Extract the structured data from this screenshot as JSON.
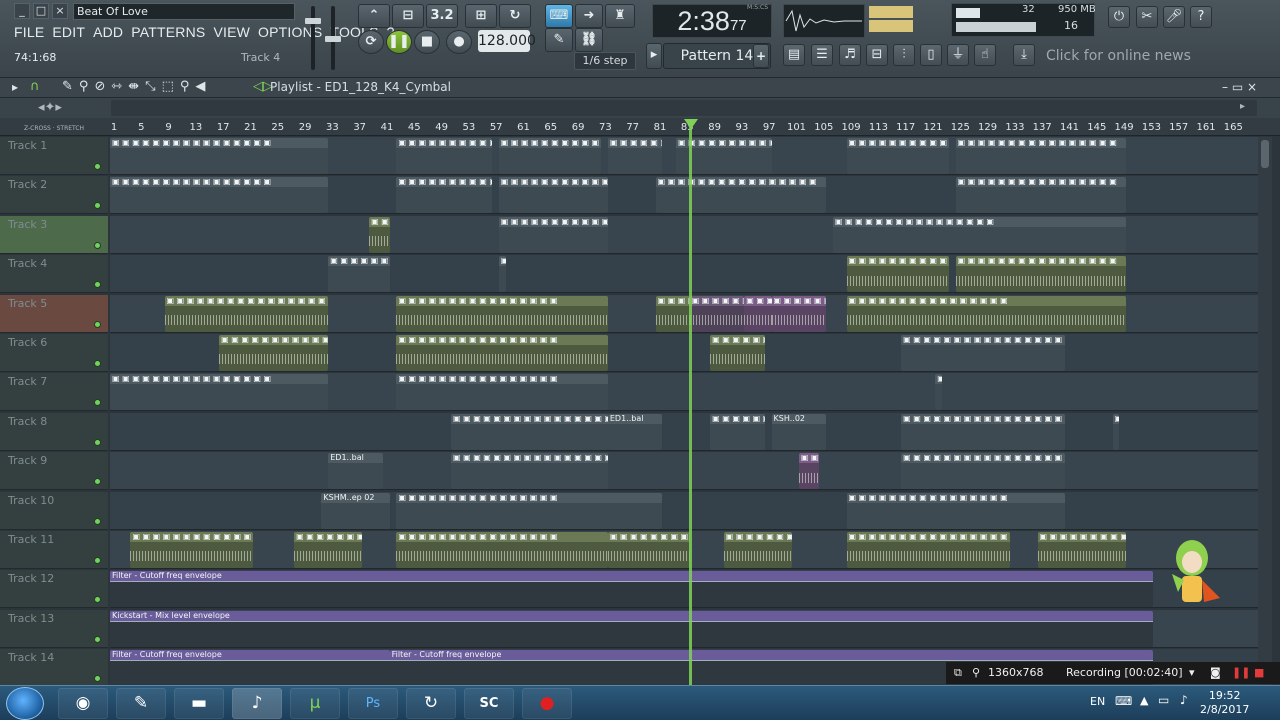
{
  "window": {
    "title": "Beat Of Love",
    "buttons": [
      "_",
      "□",
      "×"
    ]
  },
  "menu": [
    "FILE",
    "EDIT",
    "ADD",
    "PATTERNS",
    "VIEW",
    "OPTIONS",
    "TOOLS",
    "?"
  ],
  "hint": {
    "left": "74:1:68",
    "right": "Track 4"
  },
  "transport": {
    "tempo": "128.000",
    "time_main": "2:38",
    "time_sub": "77",
    "time_unit": "M:S:CS",
    "snap": "1/6 step",
    "pattern": "Pattern 14"
  },
  "meters": {
    "cpu": "32",
    "memory": "950 MB",
    "polyphony": "16"
  },
  "news": "Click for online news",
  "playlist": {
    "title": "Playlist - ED1_128_K4_Cymbal",
    "ruler_label": "Z-CROSS · STRETCH"
  },
  "ruler": [
    "1",
    "5",
    "9",
    "13",
    "17",
    "21",
    "25",
    "29",
    "33",
    "37",
    "41",
    "45",
    "49",
    "53",
    "57",
    "61",
    "65",
    "69",
    "73",
    "77",
    "81",
    "85",
    "89",
    "93",
    "97",
    "101",
    "105",
    "109",
    "113",
    "117",
    "121",
    "125",
    "129",
    "133",
    "137",
    "141",
    "145",
    "149",
    "153",
    "157",
    "161",
    "165"
  ],
  "tracks": [
    "Track 1",
    "Track 2",
    "Track 3",
    "Track 4",
    "Track 5",
    "Track 6",
    "Track 7",
    "Track 8",
    "Track 9",
    "Track 10",
    "Track 11",
    "Track 12",
    "Track 13",
    "Track 14"
  ],
  "clip_labels": {
    "ed1_bal": "ED1..bal",
    "ksh_02": "KSH..02",
    "kshm_ep02": "KSHM..ep 02",
    "filter_env": "Filter - Cutoff freq envelope",
    "kick_env": "Kickstart - Mix level envelope"
  },
  "recording": {
    "resolution": "1360x768",
    "status": "Recording [00:02:40]"
  },
  "taskbar": {
    "lang": "EN",
    "time": "19:52",
    "date": "2/8/2017",
    "apps": [
      "chrome-icon",
      "fl-icon",
      "folder-icon",
      "fl-active-icon",
      "utorrent-icon",
      "photoshop-icon",
      "recycle-icon",
      "sc-icon",
      "record-icon"
    ]
  },
  "colors": {
    "accent_green": "#7fd257",
    "envelope": "#7b6aa8",
    "clip_gray": "#5b6870",
    "clip_olive": "#6b7a55"
  }
}
